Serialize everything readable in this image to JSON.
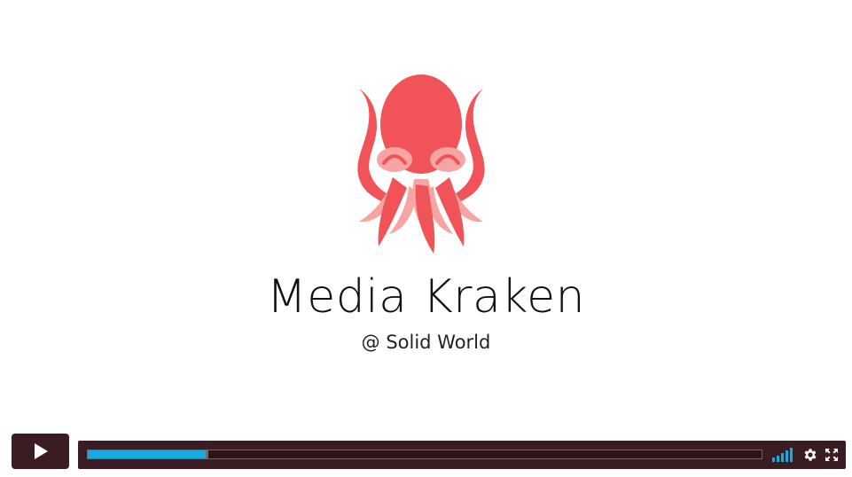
{
  "slide": {
    "title": "Media Kraken",
    "subtitle": "@ Solid World",
    "logo_icon": "octopus-logo-icon",
    "logo_color": "#f05458",
    "logo_accent_color": "#f7a5a3"
  },
  "player": {
    "background_color": "#3a1d22",
    "accent_color": "#17a9e2",
    "progress_fraction": 0.175,
    "buffered_fraction": 0.179,
    "volume_bars_lit": 5,
    "icons": {
      "play": "play-icon",
      "volume": "volume-bars-icon",
      "settings": "gear-icon",
      "fullscreen": "fullscreen-icon"
    }
  }
}
